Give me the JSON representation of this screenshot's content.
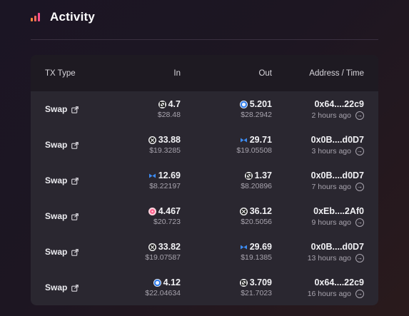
{
  "header": {
    "title": "Activity",
    "icon": "bar-chart-icon"
  },
  "table": {
    "columns": {
      "type": "TX Type",
      "in": "In",
      "out": "Out",
      "address": "Address / Time"
    },
    "rows": [
      {
        "type": "Swap",
        "in_amount": "4.7",
        "in_usd": "$28.48",
        "in_token": "black-hexagon-token-icon",
        "out_amount": "5.201",
        "out_usd": "$28.2942",
        "out_token": "blue-ring-token-icon",
        "address": "0x64....22c9",
        "time": "2 hours ago"
      },
      {
        "type": "Swap",
        "in_amount": "33.88",
        "in_usd": "$19.3285",
        "in_token": "black-cross-token-icon",
        "out_amount": "29.71",
        "out_usd": "$19.05508",
        "out_token": "blue-bowtie-token-icon",
        "address": "0x0B....d0D7",
        "time": "3 hours ago"
      },
      {
        "type": "Swap",
        "in_amount": "12.69",
        "in_usd": "$8.22197",
        "in_token": "blue-bowtie-token-icon",
        "out_amount": "1.37",
        "out_usd": "$8.20896",
        "out_token": "black-hexagon-token-icon",
        "address": "0x0B....d0D7",
        "time": "7 hours ago"
      },
      {
        "type": "Swap",
        "in_amount": "4.467",
        "in_usd": "$20.723",
        "in_token": "pink-token-icon",
        "out_amount": "36.12",
        "out_usd": "$20.5056",
        "out_token": "black-cross-token-icon",
        "address": "0xEb....2Af0",
        "time": "9 hours ago"
      },
      {
        "type": "Swap",
        "in_amount": "33.82",
        "in_usd": "$19.07587",
        "in_token": "black-cross-token-icon",
        "out_amount": "29.69",
        "out_usd": "$19.1385",
        "out_token": "blue-bowtie-token-icon",
        "address": "0x0B....d0D7",
        "time": "13 hours ago"
      },
      {
        "type": "Swap",
        "in_amount": "4.12",
        "in_usd": "$22.04634",
        "in_token": "blue-ring-token-icon",
        "out_amount": "3.709",
        "out_usd": "$21.7023",
        "out_token": "black-hexagon-token-icon",
        "address": "0x64....22c9",
        "time": "16 hours ago"
      }
    ]
  },
  "colors": {
    "accent_orange": "#ff8a3d",
    "accent_pink": "#ff4f8b",
    "card_bg": "#2a2730",
    "header_bg": "#1e1a22"
  }
}
